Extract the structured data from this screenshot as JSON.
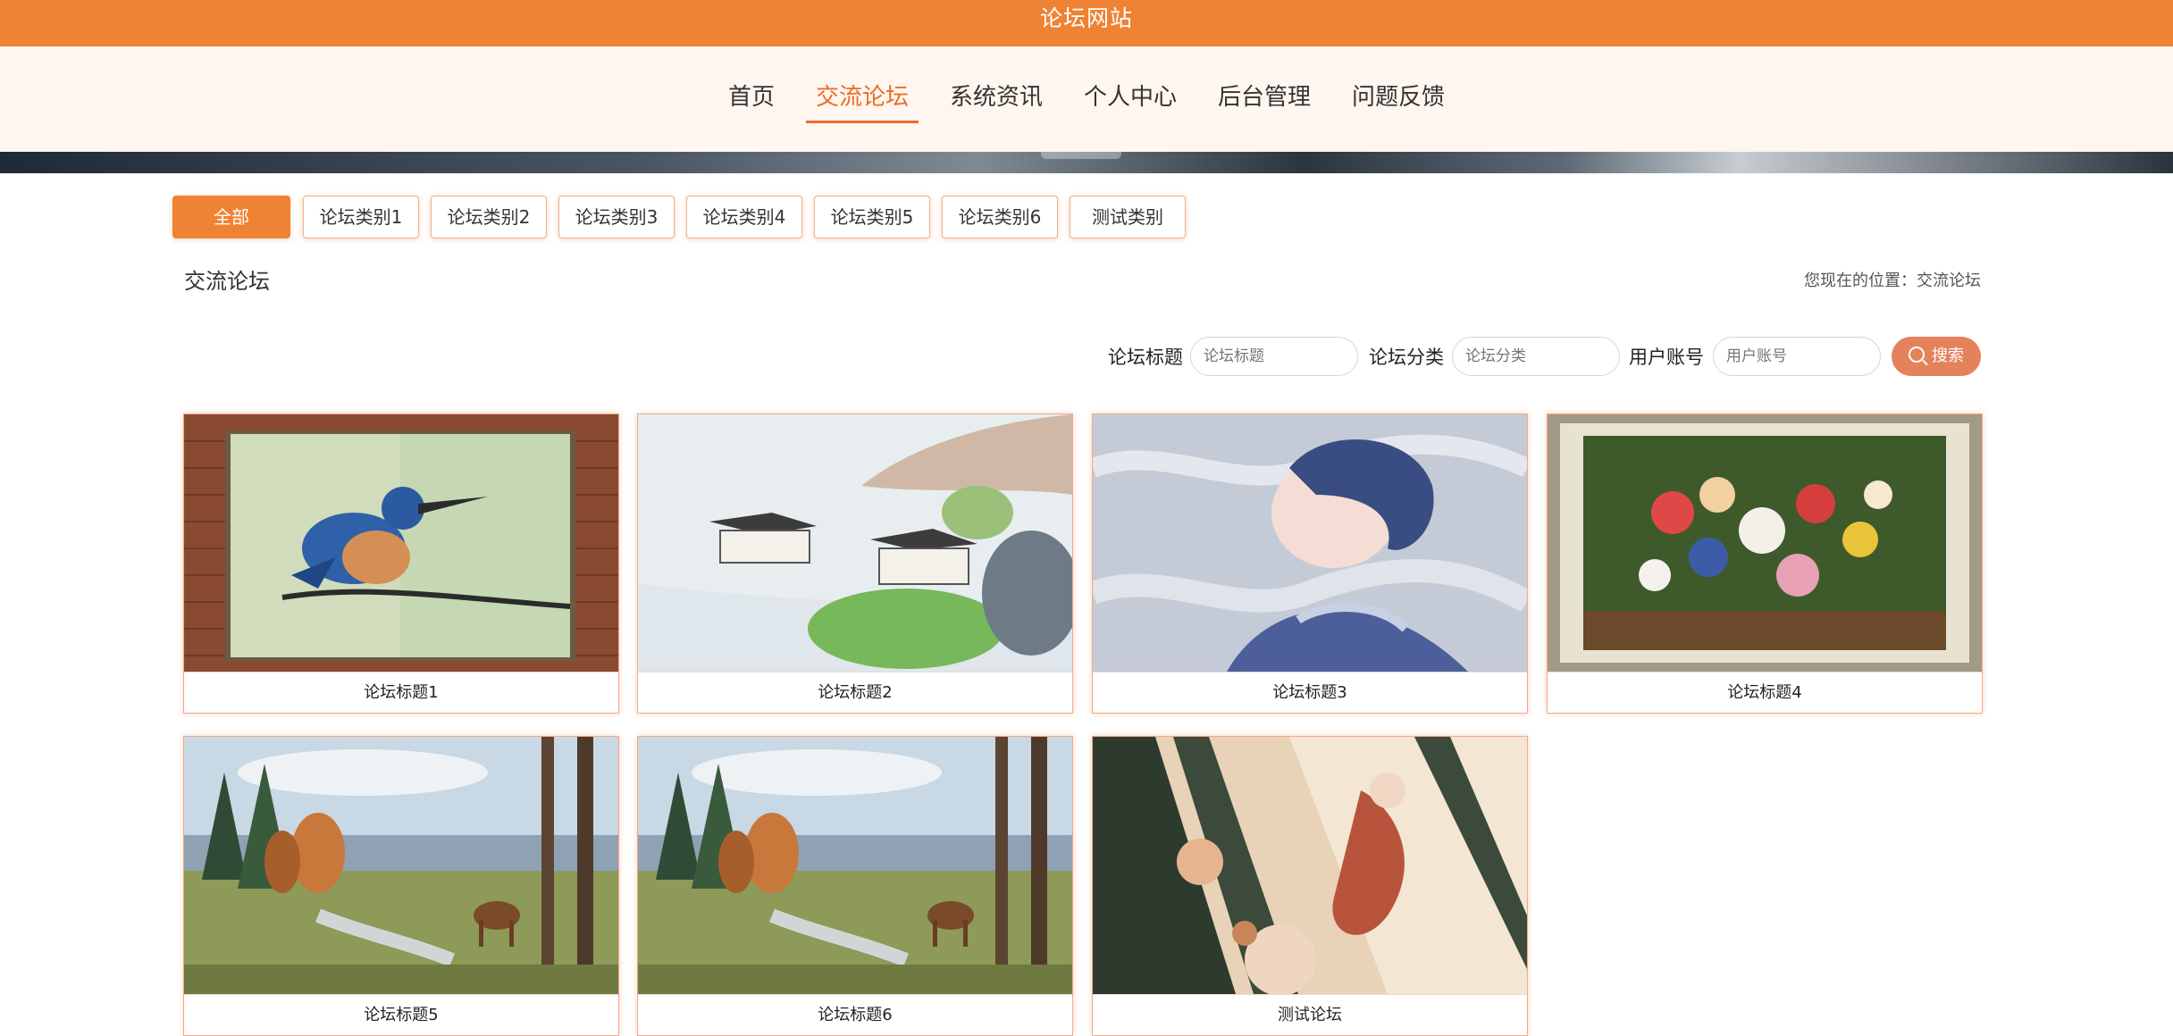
{
  "header": {
    "site_title": "论坛网站"
  },
  "nav": [
    {
      "label": "首页",
      "active": false
    },
    {
      "label": "交流论坛",
      "active": true
    },
    {
      "label": "系统资讯",
      "active": false
    },
    {
      "label": "个人中心",
      "active": false
    },
    {
      "label": "后台管理",
      "active": false
    },
    {
      "label": "问题反馈",
      "active": false
    }
  ],
  "categories": [
    "全部",
    "论坛类别1",
    "论坛类别2",
    "论坛类别3",
    "论坛类别4",
    "论坛类别5",
    "论坛类别6",
    "测试类别"
  ],
  "section": {
    "title": "交流论坛",
    "location_prefix": "您现在的位置：",
    "location_value": "交流论坛"
  },
  "search": {
    "title_label": "论坛标题",
    "title_placeholder": "论坛标题",
    "category_label": "论坛分类",
    "category_placeholder": "论坛分类",
    "user_label": "用户账号",
    "user_placeholder": "用户账号",
    "button_label": "搜索"
  },
  "posts": [
    {
      "title": "论坛标题1",
      "image": "kingfisher-painting"
    },
    {
      "title": "论坛标题2",
      "image": "chinese-landscape-painting"
    },
    {
      "title": "论坛标题3",
      "image": "anime-boy-portrait"
    },
    {
      "title": "论坛标题4",
      "image": "flower-still-life"
    },
    {
      "title": "论坛标题5",
      "image": "forest-deer-painting"
    },
    {
      "title": "论坛标题6",
      "image": "forest-deer-painting"
    },
    {
      "title": "测试论坛",
      "image": "anime-girl-illustration"
    }
  ],
  "colors": {
    "brand": "#ef8233",
    "nav_bg": "#fff6ef",
    "search_button": "#e4825b"
  }
}
